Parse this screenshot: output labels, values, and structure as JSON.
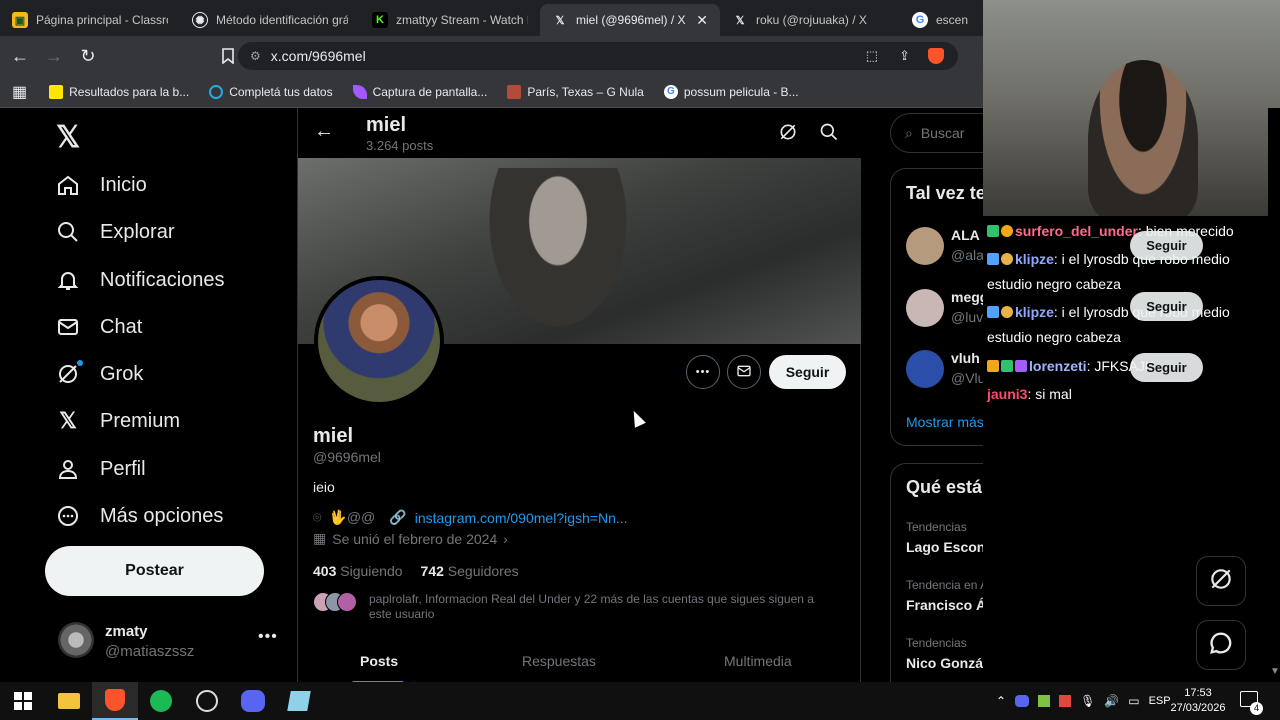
{
  "browser": {
    "tabs": [
      {
        "title": "Página principal - Classroo",
        "icon": "classroom-icon",
        "color": "#f5ba14"
      },
      {
        "title": "Método identificación gráf",
        "icon": "openai-icon",
        "color": "#e8eaed"
      },
      {
        "title": "zmattyy Stream - Watch Li",
        "icon": "kick-icon",
        "color": "#53fc18"
      },
      {
        "title": "miel (@9696mel) / X",
        "icon": "x-icon",
        "color": "#e8eaed"
      },
      {
        "title": "roku (@rojuuaka) / X",
        "icon": "x-icon",
        "color": "#e8eaed"
      },
      {
        "title": "escena de",
        "icon": "google-icon",
        "color": "#4285f4"
      }
    ],
    "url": "x.com/9696mel",
    "bookmarks": [
      {
        "label": "Resultados para la b...",
        "icon": "mercadolibre-icon",
        "color": "#ffe600"
      },
      {
        "label": "Completá tus datos",
        "icon": "circle-icon",
        "color": "#29a8e0"
      },
      {
        "label": "Captura de pantalla...",
        "icon": "feather-icon",
        "color": "#a259ff"
      },
      {
        "label": "París, Texas – G Nula",
        "icon": "image-icon",
        "color": "#b34a3a"
      },
      {
        "label": "possum pelicula - B...",
        "icon": "google-icon",
        "color": "#4285f4"
      }
    ]
  },
  "left_nav": {
    "items": [
      {
        "label": "Inicio",
        "icon": "home-icon"
      },
      {
        "label": "Explorar",
        "icon": "search-icon"
      },
      {
        "label": "Notificaciones",
        "icon": "bell-icon"
      },
      {
        "label": "Chat",
        "icon": "mail-icon"
      },
      {
        "label": "Grok",
        "icon": "grok-icon"
      },
      {
        "label": "Premium",
        "icon": "x-icon"
      },
      {
        "label": "Perfil",
        "icon": "person-icon"
      },
      {
        "label": "Más opciones",
        "icon": "more-circle-icon"
      }
    ],
    "post_label": "Postear",
    "account": {
      "name": "zmaty",
      "handle": "@matiaszssz"
    }
  },
  "profile": {
    "header_name": "miel",
    "post_count": "3.264 posts",
    "name": "miel",
    "handle": "@9696mel",
    "bio": "ieio",
    "location": "🖖@@",
    "link": "instagram.com/090mel?igsh=Nn...",
    "joined": "Se unió el febrero de 2024",
    "following_count": "403",
    "following_label": "Siguiendo",
    "followers_count": "742",
    "followers_label": "Seguidores",
    "followed_by": "paplrolafr, Informacion Real del Under y 22 más de las cuentas que sigues siguen a este usuario",
    "follow_label": "Seguir",
    "tabs": [
      "Posts",
      "Respuestas",
      "Multimedia"
    ]
  },
  "right_col": {
    "search_placeholder": "Buscar",
    "who_to_follow_title": "Tal vez te",
    "suggestions": [
      {
        "name": "ALA",
        "handle": "@alarl",
        "follow": "Seguir"
      },
      {
        "name": "meggo @@@",
        "handle": "@luvm",
        "follow": "Seguir"
      },
      {
        "name": "vluh",
        "handle": "@Vluhh_",
        "follow": "Seguir"
      }
    ],
    "show_more": "Mostrar más",
    "trends_title": "Qué está pasando",
    "trends": [
      {
        "context": "Tendencias",
        "name": "Lago Escondido"
      },
      {
        "context": "Tendencia en Argentina",
        "name": "Francisco Álvarez"
      },
      {
        "context": "Tendencias",
        "name": "Nico González"
      }
    ]
  },
  "stream_chat": [
    {
      "user": "surfero_del_under",
      "color": "#ff6b8b",
      "text": ": bien merecido"
    },
    {
      "user": "klipze",
      "color": "#8fa8ff",
      "text": ": i el lyrosdb que robo medio"
    },
    {
      "user": "",
      "color": "#ffffff",
      "text": "estudio negro cabeza"
    },
    {
      "user": "klipze",
      "color": "#8fa8ff",
      "text": ": i el lyrosdb que robo medio"
    },
    {
      "user": "",
      "color": "#ffffff",
      "text": "estudio negro cabeza"
    },
    {
      "user": "lorenzeti",
      "color": "#9fb4ff",
      "text": ": JFKSAJK"
    },
    {
      "user": "jauni3",
      "color": "#ff4b6e",
      "text": ": si mal"
    }
  ],
  "taskbar": {
    "language": "ESP",
    "time": "17:53",
    "date": "27/03/2026",
    "notifications": "4"
  }
}
